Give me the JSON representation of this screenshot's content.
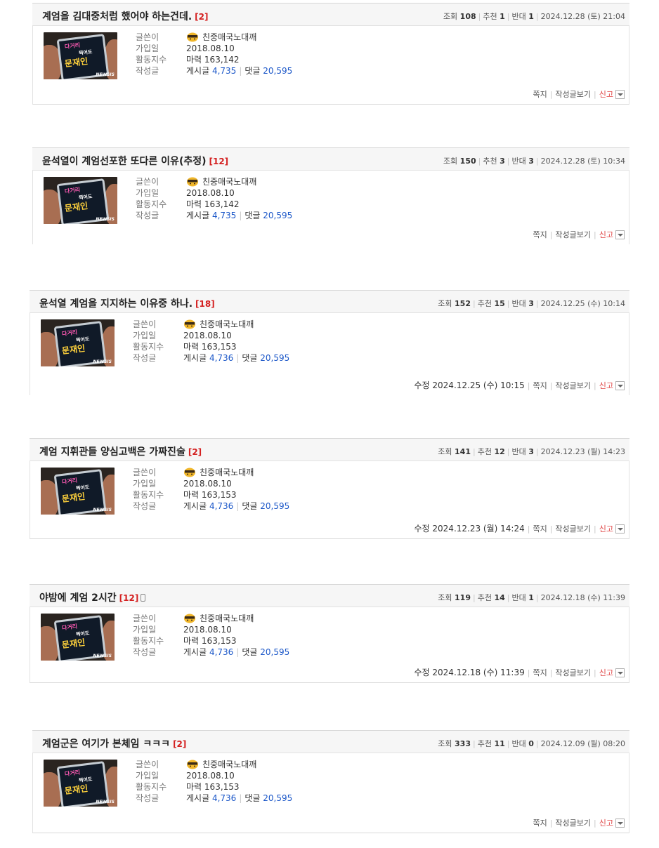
{
  "author": {
    "label_writer": "글쓴이",
    "label_joined": "가입일",
    "label_activity": "활동지수",
    "label_posts": "작성글",
    "nickname": "친중매국노대깨",
    "joined": "2018.08.10",
    "avatar_text": {
      "line1": "다거리",
      "line2": "찍어도",
      "line3": "문재인",
      "brand": "NEWSIS"
    }
  },
  "labels": {
    "views": "조회",
    "upvotes": "추천",
    "downvotes": "반대",
    "mana": "마력",
    "posts": "게시글",
    "comments": "댓글",
    "message": "쪽지",
    "view_posts": "작성글보기",
    "report": "신고",
    "edited": "수정"
  },
  "posts": [
    {
      "title": "계엄을 김대중처럼 했어야 하는건데.",
      "comment_count": "[2]",
      "views": "108",
      "upvotes": "1",
      "downvotes": "1",
      "date": "2024.12.28 (토) 21:04",
      "mana": "163,142",
      "post_count": "4,735",
      "comment_total": "20,595",
      "edited": ""
    },
    {
      "title": "윤석열이 계엄선포한 또다른 이유(추정)",
      "comment_count": "[12]",
      "views": "150",
      "upvotes": "3",
      "downvotes": "3",
      "date": "2024.12.28 (토) 10:34",
      "mana": "163,142",
      "post_count": "4,735",
      "comment_total": "20,595",
      "edited": ""
    },
    {
      "title": "윤석열 계엄을 지지하는 이유중 하나.",
      "comment_count": "[18]",
      "views": "152",
      "upvotes": "15",
      "downvotes": "3",
      "date": "2024.12.25 (수) 10:14",
      "mana": "163,153",
      "post_count": "4,736",
      "comment_total": "20,595",
      "edited": "2024.12.25 (수) 10:15"
    },
    {
      "title": "계엄 지휘관들 양심고백은 가짜진술",
      "comment_count": "[2]",
      "views": "141",
      "upvotes": "12",
      "downvotes": "3",
      "date": "2024.12.23 (월) 14:23",
      "mana": "163,153",
      "post_count": "4,736",
      "comment_total": "20,595",
      "edited": "2024.12.23 (월) 14:24"
    },
    {
      "title": "야밤에 계엄 2시간",
      "comment_count": "[12]",
      "views": "119",
      "upvotes": "14",
      "downvotes": "1",
      "date": "2024.12.18 (수) 11:39",
      "mana": "163,153",
      "post_count": "4,736",
      "comment_total": "20,595",
      "edited": "2024.12.18 (수) 11:39",
      "mobile_icon": "mobile-phone-icon"
    },
    {
      "title": "계엄군은 여기가 본체임 ㅋㅋㅋ",
      "comment_count": "[2]",
      "views": "333",
      "upvotes": "11",
      "downvotes": "0",
      "date": "2024.12.09 (월) 08:20",
      "mana": "163,153",
      "post_count": "4,736",
      "comment_total": "20,595",
      "edited": ""
    }
  ]
}
